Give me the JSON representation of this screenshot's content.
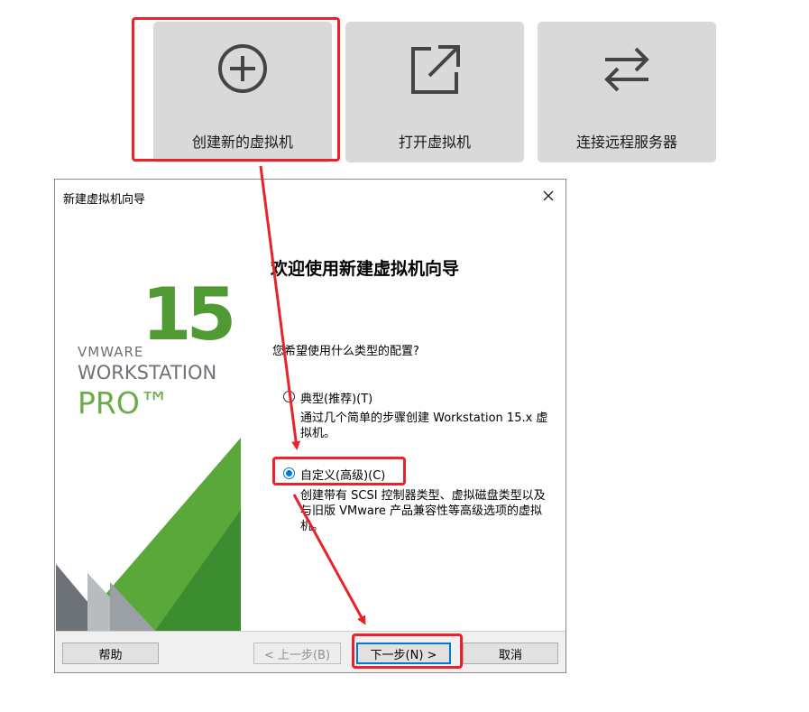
{
  "tiles": [
    {
      "label": "创建新的虚拟机",
      "icon": "plus-circle-icon"
    },
    {
      "label": "打开虚拟机",
      "icon": "external-link-icon"
    },
    {
      "label": "连接远程服务器",
      "icon": "swap-arrows-icon"
    }
  ],
  "dialog": {
    "title": "新建虚拟机向导",
    "close_icon": "close-icon",
    "banner": {
      "brand": "VMWARE",
      "version": "15",
      "product": "WORKSTATION",
      "edition": "PRO™",
      "colors": {
        "green": "#5aa83a",
        "dark_green": "#2e7d32",
        "gray": "#6d7278"
      }
    },
    "heading": "欢迎使用新建虚拟机向导",
    "question": "您希望使用什么类型的配置?",
    "options": [
      {
        "label": "典型(推荐)(T)",
        "description": "通过几个简单的步骤创建 Workstation 15.x 虚拟机。",
        "selected": false
      },
      {
        "label": "自定义(高级)(C)",
        "description": "创建带有 SCSI 控制器类型、虚拟磁盘类型以及与旧版 VMware 产品兼容性等高级选项的虚拟机。",
        "selected": true
      }
    ],
    "buttons": {
      "help": "帮助",
      "back": "< 上一步(B)",
      "next": "下一步(N) >",
      "cancel": "取消"
    }
  },
  "annotation_color": "#e8232a"
}
